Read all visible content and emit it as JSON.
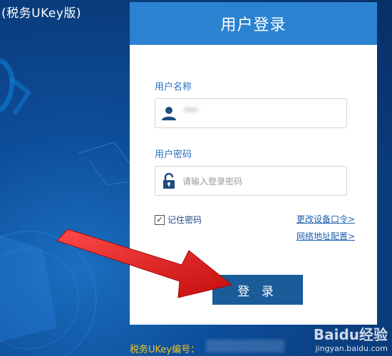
{
  "window": {
    "product_title": "(税务UKey版)"
  },
  "login": {
    "header_title": "用户登录",
    "username_label": "用户名称",
    "username_value": "***",
    "password_label": "用户密码",
    "password_placeholder": "请输入登录密码",
    "remember_label": "记住密码",
    "remember_checked": "✓",
    "change_password_link": "更改设备口令>",
    "network_config_link": "网络地址配置>",
    "submit_label": "登 录"
  },
  "footer": {
    "ukey_label": "税务UKey编号："
  },
  "watermark": {
    "brand": "Baidu经验",
    "url": "jingyan.baidu.com"
  },
  "colors": {
    "header_blue": "#2b82d0",
    "button_blue": "#1a5c99",
    "ukey_label": "#f2c318",
    "arrow_red": "#e31b1b"
  },
  "icons": [
    "user-icon",
    "lock-icon",
    "checkbox-icon",
    "red-arrow-icon"
  ]
}
